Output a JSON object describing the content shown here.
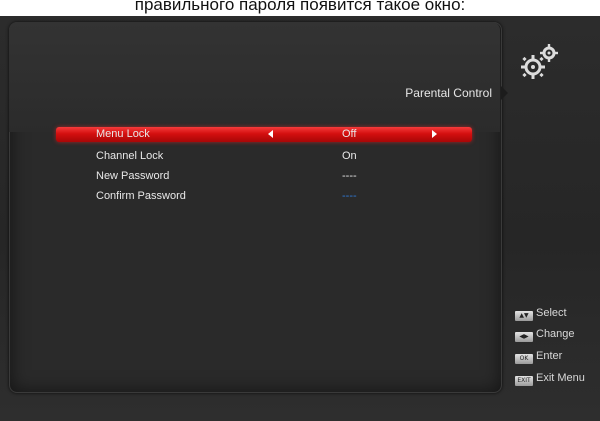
{
  "caption": "правильного пароля появится такое окно:",
  "header": {
    "title": "Parental Control",
    "icon": "gears-icon"
  },
  "menu": {
    "rows": [
      {
        "label": "Menu Lock",
        "value": "Off"
      },
      {
        "label": "Channel Lock",
        "value": "On"
      },
      {
        "label": "New Password",
        "value": "----"
      },
      {
        "label": "Confirm Password",
        "value": "----"
      }
    ],
    "selected_index": 0
  },
  "legend": {
    "items": [
      {
        "key": "▲▼",
        "label": "Select",
        "icon": "updown-key-icon"
      },
      {
        "key": "◀▶",
        "label": "Change",
        "icon": "leftright-key-icon"
      },
      {
        "key": "OK",
        "label": "Enter",
        "icon": "ok-key-icon"
      },
      {
        "key": "EXIT",
        "label": "Exit Menu",
        "icon": "exit-key-icon"
      }
    ]
  },
  "colors": {
    "selection_red": "#d40f0f",
    "confirm_value_blue": "#2f79d8",
    "background": "#2a2a2a"
  }
}
